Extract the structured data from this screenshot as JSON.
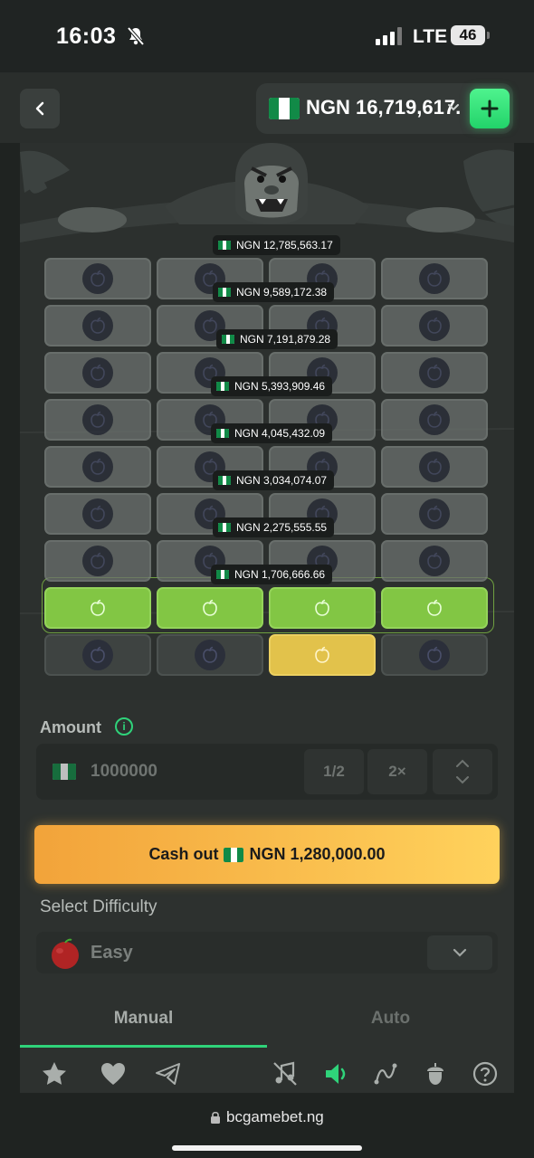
{
  "status_bar": {
    "time": "16:03",
    "network": "LTE",
    "battery": "46"
  },
  "header": {
    "balance": "NGN 16,719,617."
  },
  "game": {
    "multipliers": [
      "NGN 12,785,563.17",
      "NGN 9,589,172.38",
      "NGN 7,191,879.28",
      "NGN 5,393,909.46",
      "NGN 4,045,432.09",
      "NGN 3,034,074.07",
      "NGN 2,275,555.55",
      "NGN 1,706,666.66"
    ],
    "columns": 4,
    "rows": 9,
    "row_states": [
      "inactive",
      "inactive",
      "inactive",
      "inactive",
      "inactive",
      "inactive",
      "inactive",
      "won",
      "picked"
    ],
    "picked_tile": {
      "row": 9,
      "column": 3
    },
    "colors": {
      "won_tile": "#82c644",
      "picked_tile": "#e2c24b",
      "accent": "#2fd37a"
    }
  },
  "controls": {
    "amount_label": "Amount",
    "amount_value": "1000000",
    "half_label": "1/2",
    "double_label": "2×",
    "cashout_prefix": "Cash out",
    "cashout_amount": "NGN 1,280,000.00",
    "difficulty_label": "Select Difficulty",
    "difficulty_value": "Easy",
    "tabs": {
      "manual": "Manual",
      "auto": "Auto"
    }
  },
  "toolbar": {
    "icons": [
      "star-icon",
      "heart-icon",
      "telegram-icon",
      "music-off-icon",
      "sound-icon",
      "chart-icon",
      "acorn-icon",
      "help-icon"
    ]
  },
  "browser": {
    "url": "bcgamebet.ng"
  }
}
